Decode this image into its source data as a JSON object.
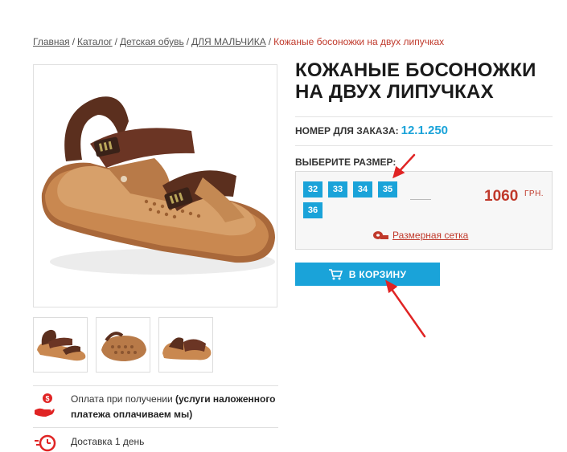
{
  "breadcrumbs": [
    {
      "label": "Главная"
    },
    {
      "label": "Каталог"
    },
    {
      "label": "Детская обувь"
    },
    {
      "label": "ДЛЯ МАЛЬЧИКА"
    }
  ],
  "breadcrumb_separator": "/",
  "breadcrumb_current": "Кожаные босоножки на двух липучках",
  "product": {
    "title_line1": "КОЖАНЫЕ БОСОНОЖКИ",
    "title_line2": "НА ДВУХ ЛИПУЧКАХ",
    "order_label": "НОМЕР ДЛЯ ЗАКАЗА:",
    "order_code": "12.1.250",
    "size_label": "ВЫБЕРИТЕ РАЗМЕР:",
    "sizes": [
      "32",
      "33",
      "34",
      "35",
      "36"
    ],
    "price": "1060",
    "currency": "ГРН.",
    "size_chart_label": "Размерная сетка",
    "cart_button_label": "В КОРЗИНУ"
  },
  "info": {
    "payment_text": "Оплата при получении ",
    "payment_bold": "(услуги наложенного платежа оплачиваем мы)",
    "delivery_text": "Доставка 1 день"
  },
  "colors": {
    "accent_blue": "#1aa3d9",
    "price_red": "#c0392b",
    "arrow_red": "#e02424"
  },
  "icons": [
    "cart-icon",
    "ruler-tape-icon",
    "payment-hand-icon",
    "clock-icon",
    "arrow-annotation"
  ]
}
